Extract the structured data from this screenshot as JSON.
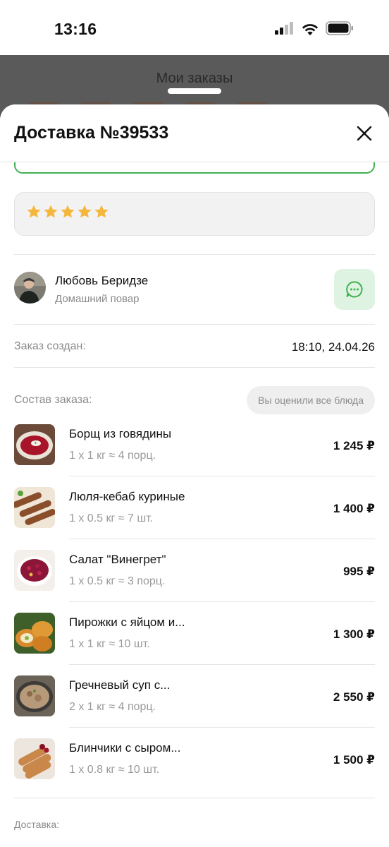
{
  "status_bar": {
    "time": "13:16"
  },
  "background_screen": {
    "title": "Мои заказы"
  },
  "sheet": {
    "title": "Доставка №39533"
  },
  "rating": {
    "stars": 5,
    "max_stars": 5,
    "color": "#F5B63C"
  },
  "chef": {
    "name": "Любовь Беридзе",
    "role": "Домашний повар",
    "chat_icon": "chat-bubble-icon"
  },
  "order_created": {
    "label": "Заказ создан:",
    "value": "18:10, 24.04.26"
  },
  "composition": {
    "label": "Состав заказа:",
    "rated_badge": "Вы оценили все блюда",
    "items": [
      {
        "name": "Борщ из говядины",
        "qty": "1 x 1 кг ≈ 4 порц.",
        "price": "1 245 ₽"
      },
      {
        "name": "Люля-кебаб куриные",
        "qty": "1 x 0.5 кг ≈ 7 шт.",
        "price": "1 400 ₽"
      },
      {
        "name": "Салат \"Винегрет\"",
        "qty": "1 x 0.5 кг ≈ 3 порц.",
        "price": "995 ₽"
      },
      {
        "name": "Пирожки с яйцом и...",
        "qty": "1 x 1 кг ≈ 10 шт.",
        "price": "1 300 ₽"
      },
      {
        "name": "Гречневый суп с...",
        "qty": "2 x 1 кг ≈ 4 порц.",
        "price": "2 550 ₽"
      },
      {
        "name": "Блинчики с сыром...",
        "qty": "1 x 0.8 кг ≈ 10 шт.",
        "price": "1 500 ₽"
      }
    ]
  },
  "delivery": {
    "label": "Доставка:"
  },
  "colors": {
    "accent_green": "#3FB24E",
    "chat_button_bg": "#DFF3E3"
  }
}
